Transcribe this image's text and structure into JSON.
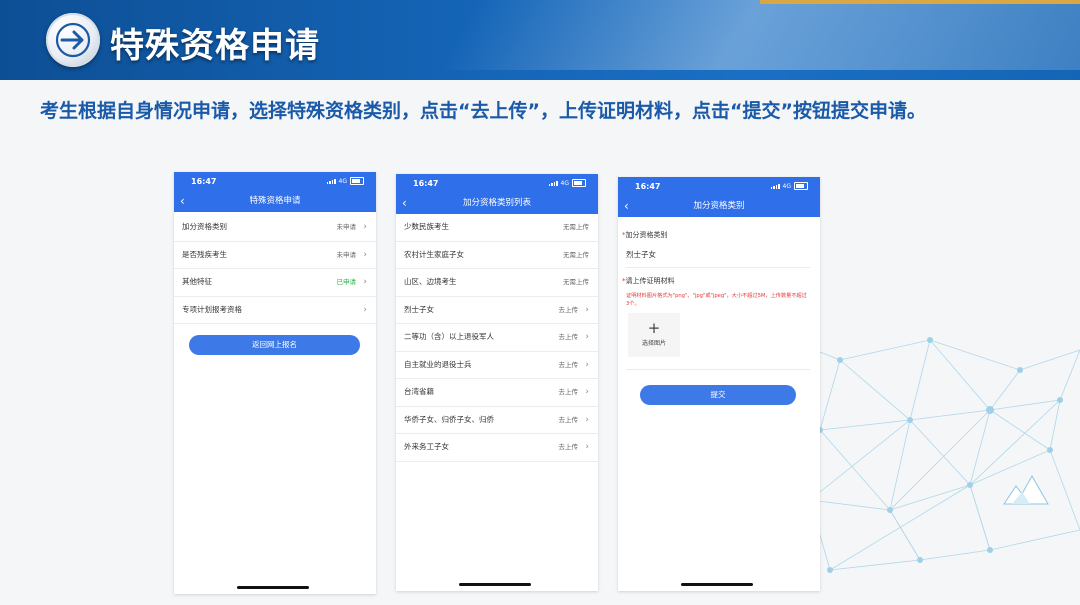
{
  "header": {
    "title": "特殊资格申请",
    "subtitle": "考生根据自身情况申请，选择特殊资格类别，点击“去上传”，上传证明材料，点击“提交”按钮提交申请。"
  },
  "colors": {
    "banner": "#1565b8",
    "accent": "#2f6fe9",
    "subtitle": "#1a5aa8",
    "success": "#27b24a",
    "required": "#e03a3a"
  },
  "phone1": {
    "time": "16:47",
    "network": "4G",
    "nav_title": "特殊资格申请",
    "rows": [
      {
        "label": "加分资格类别",
        "status": "未申请"
      },
      {
        "label": "是否残疾考生",
        "status": "未申请"
      },
      {
        "label": "其他特征",
        "status": "已申请"
      },
      {
        "label": "专项计划报考资格",
        "status": ""
      }
    ],
    "button": "返回网上报名"
  },
  "phone2": {
    "time": "16:47",
    "network": "4G",
    "nav_title": "加分资格类别列表",
    "rows": [
      {
        "label": "少数民族考生",
        "status": "无需上传"
      },
      {
        "label": "农村计生家庭子女",
        "status": "无需上传"
      },
      {
        "label": "山区、边境考生",
        "status": "无需上传"
      },
      {
        "label": "烈士子女",
        "status": "去上传"
      },
      {
        "label": "二等功（含）以上退役军人",
        "status": "去上传"
      },
      {
        "label": "自主就业的退役士兵",
        "status": "去上传"
      },
      {
        "label": "台湾省籍",
        "status": "去上传"
      },
      {
        "label": "华侨子女、归侨子女、归侨",
        "status": "去上传"
      },
      {
        "label": "外来务工子女",
        "status": "去上传"
      }
    ]
  },
  "phone3": {
    "time": "16:47",
    "network": "4G",
    "nav_title": "加分资格类别",
    "field_label": "加分资格类别",
    "field_value": "烈士子女",
    "upload_label": "请上传证明材料",
    "upload_hint": "证明材料图片格式为\"png\"、\"jpg\"或\"jpeg\"，大小不超过5M，上传数量不超过3个。",
    "upload_box_label": "选择图片",
    "required_mark": "*",
    "submit": "提交"
  }
}
